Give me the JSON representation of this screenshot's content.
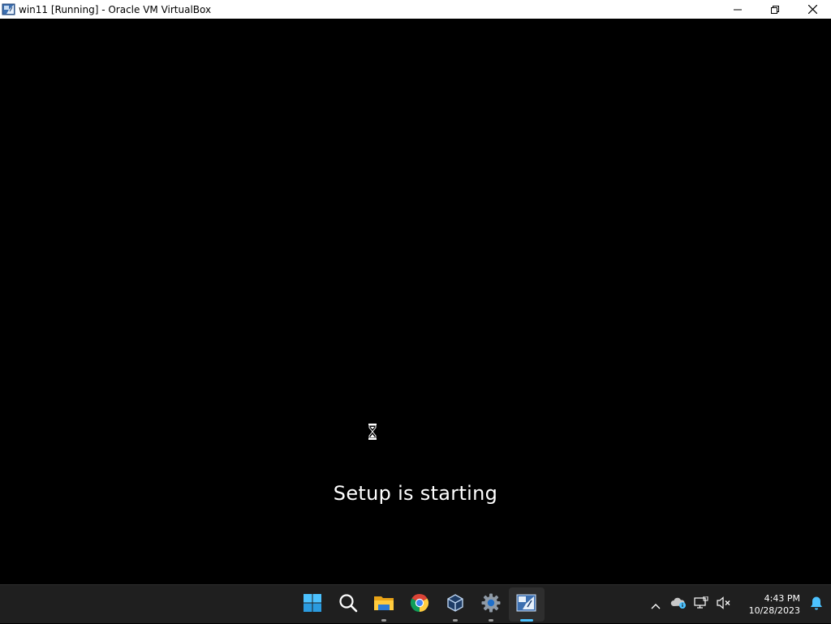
{
  "window": {
    "title": "win11 [Running] - Oracle VM VirtualBox",
    "app_icon": "virtualbox-icon",
    "controls": [
      "minimize-icon",
      "restore-icon",
      "close-icon"
    ]
  },
  "vm_screen": {
    "status_text": "Setup is starting",
    "cursor": "hourglass-cursor-icon",
    "background": "#000000"
  },
  "taskbar": {
    "apps": [
      {
        "name": "start-icon",
        "running": false
      },
      {
        "name": "search-icon",
        "running": false
      },
      {
        "name": "file-explorer-icon",
        "running": true
      },
      {
        "name": "chrome-icon",
        "running": false
      },
      {
        "name": "virtualbox-manager-icon",
        "running": true
      },
      {
        "name": "settings-icon",
        "running": true
      },
      {
        "name": "virtualbox-vm-icon",
        "running": true,
        "active": true
      }
    ],
    "tray": {
      "icons": [
        "chevron-up-icon",
        "onedrive-icon",
        "network-icon",
        "volume-muted-icon"
      ],
      "time": "4:43 PM",
      "date": "10/28/2023",
      "notification": "bell-icon"
    },
    "accent": "#4cc2ff"
  }
}
